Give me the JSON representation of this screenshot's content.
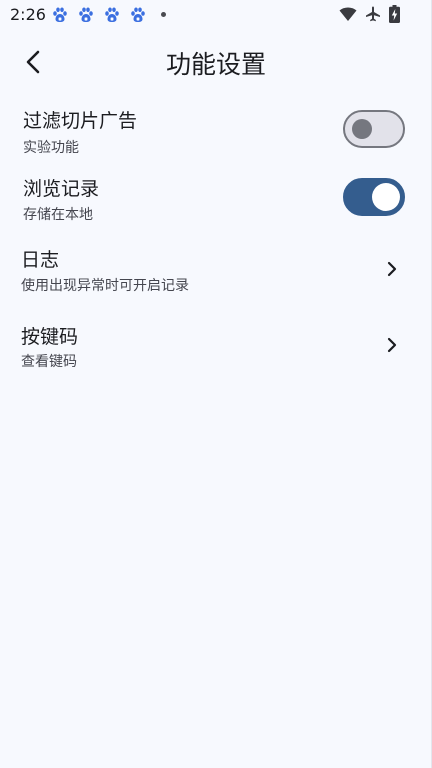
{
  "status_bar": {
    "time": "2:26",
    "notification_icons": [
      "baidu-paw-icon",
      "baidu-paw-icon",
      "baidu-paw-icon",
      "baidu-paw-icon"
    ],
    "system_icons": [
      "wifi-icon",
      "airplane-icon",
      "battery-charging-icon"
    ]
  },
  "header": {
    "title": "功能设置",
    "back_icon": "back-arrow-icon"
  },
  "settings": [
    {
      "title": "过滤切片广告",
      "subtitle": "实验功能",
      "control": "switch",
      "checked": false
    },
    {
      "title": "浏览记录",
      "subtitle": "存储在本地",
      "control": "switch",
      "checked": true
    },
    {
      "title": "日志",
      "subtitle": "使用出现异常时可开启记录",
      "control": "chevron-right-icon"
    },
    {
      "title": "按键码",
      "subtitle": "查看键码",
      "control": "chevron-right-icon"
    }
  ],
  "colors": {
    "background": "#f7f9fe",
    "accent": "#345d8e",
    "paw_blue": "#3b6fe0",
    "switch_off_track": "#e2e2ea",
    "switch_off_outline": "#75777f"
  }
}
